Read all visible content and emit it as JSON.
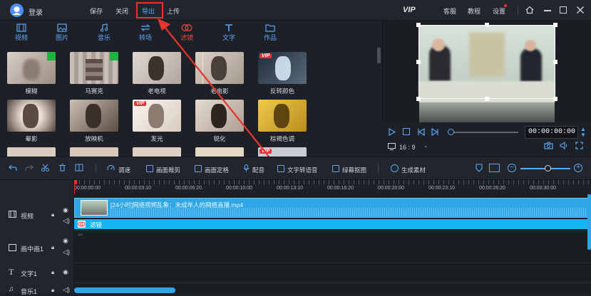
{
  "titlebar": {
    "login": "登录",
    "menu": [
      "保存",
      "关闭",
      "导出",
      "上传"
    ],
    "vip": "VIP",
    "right_menu": [
      "客服",
      "教程",
      "设置"
    ]
  },
  "toolbar": {
    "tools": [
      "视频",
      "图片",
      "音乐",
      "转场",
      "滤镜",
      "文字",
      "作品"
    ]
  },
  "effects": {
    "items": [
      {
        "label": "模糊",
        "badge": "green"
      },
      {
        "label": "马赛克",
        "badge": "green"
      },
      {
        "label": "老电视",
        "badge": ""
      },
      {
        "label": "老电影",
        "badge": ""
      },
      {
        "label": "反转颜色",
        "badge": "vip"
      },
      {
        "label": "晕影",
        "badge": ""
      },
      {
        "label": "放映机",
        "badge": ""
      },
      {
        "label": "发光",
        "badge": "vip"
      },
      {
        "label": "锐化",
        "badge": ""
      },
      {
        "label": "棕褐色调",
        "badge": ""
      }
    ],
    "vip_text": "VIP"
  },
  "preview": {
    "timecode": "00:00:00:00",
    "aspect": "16 : 9"
  },
  "timeline_tools": {
    "items": [
      "调速",
      "画面裁剪",
      "画面定格",
      "配音",
      "文字转语音",
      "绿幕抠图",
      "生成素材"
    ]
  },
  "ruler": {
    "ticks": [
      "00:00:00:00",
      "00:00:03:10",
      "00:00:06:20",
      "00:00:10:00",
      "00:00:13:10",
      "00:00:16:20",
      "00:00:20:00",
      "00:00:23:10",
      "00:00:26:20",
      "00:00:30:00"
    ]
  },
  "tracks": {
    "labels": [
      "视频",
      "画中画1",
      "文字1",
      "音乐1"
    ],
    "clip_name": "[24小时]网络视频乱象：未成年人的网络直播.mp4",
    "filter_name": "滤镜"
  },
  "colors": {
    "accent": "#5aa7f5",
    "clip": "#2fa7e6",
    "filter": "#12b5f0",
    "annotation": "#e8342c"
  }
}
